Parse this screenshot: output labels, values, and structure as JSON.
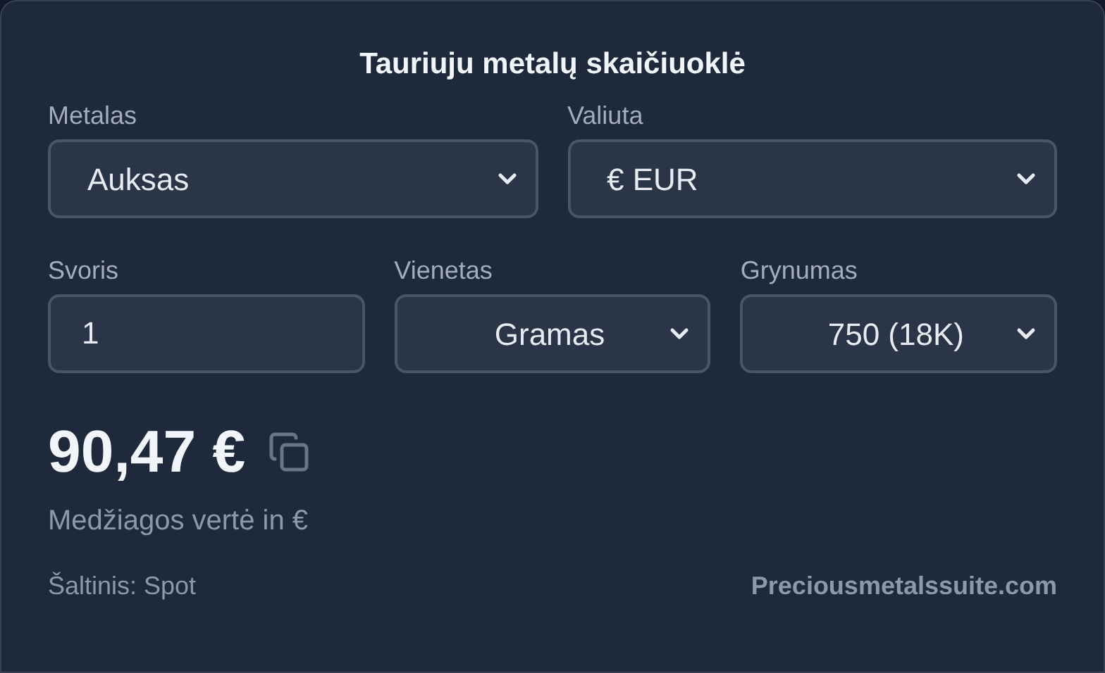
{
  "title": "Tauriuju metalų skaičiuoklė",
  "fields_row_1": [
    {
      "kind": "select",
      "label": "Metalas",
      "value": "Auksas"
    },
    {
      "kind": "select",
      "label": "Valiuta",
      "value": "€ EUR"
    }
  ],
  "fields_row_2": [
    {
      "kind": "input",
      "label": "Svoris",
      "value": "1"
    },
    {
      "kind": "select",
      "label": "Vienetas",
      "value": "Gramas"
    },
    {
      "kind": "select",
      "label": "Grynumas",
      "value": "750 (18K)"
    }
  ],
  "result": {
    "value": "90,47 €",
    "caption": "Medžiagos vertė in €"
  },
  "footer": {
    "source": "Šaltinis: Spot",
    "link": "Preciousmetalssuite.com"
  }
}
